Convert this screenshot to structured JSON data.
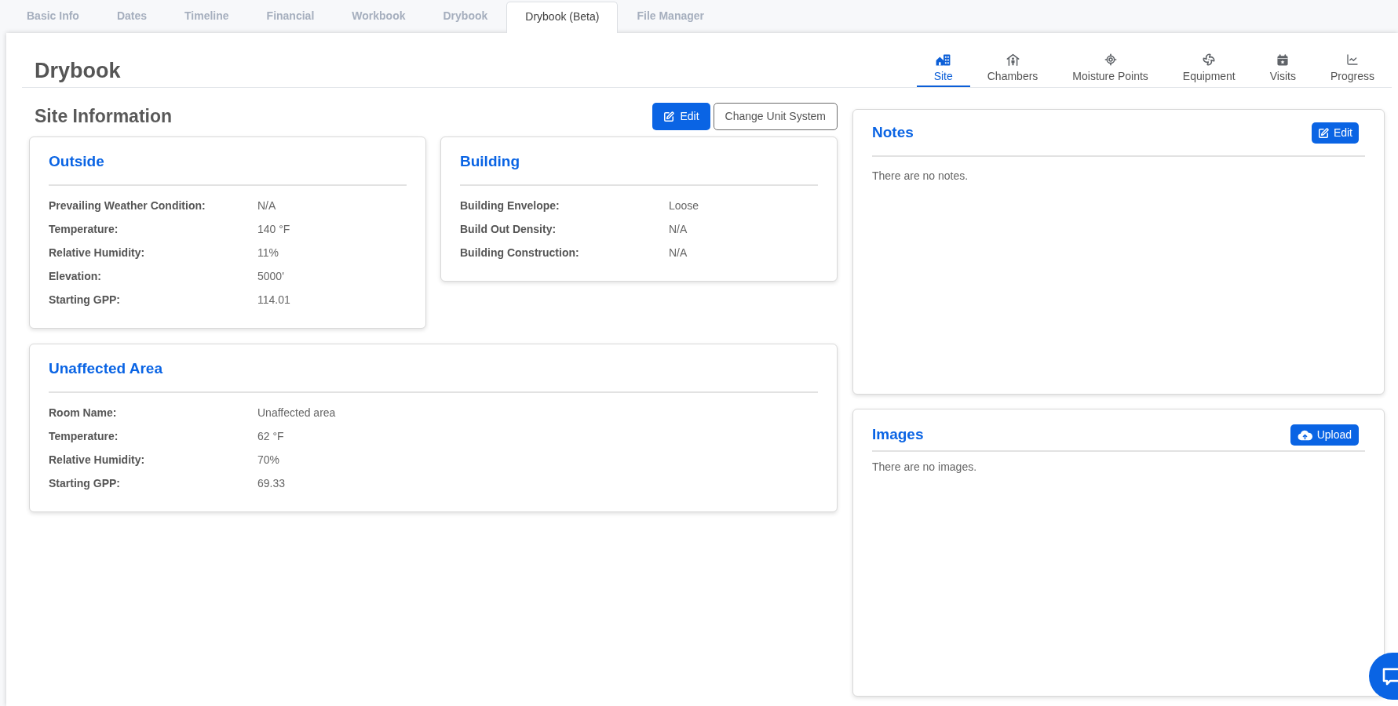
{
  "top_tabs": [
    {
      "label": "Basic Info",
      "selected": false
    },
    {
      "label": "Dates",
      "selected": false
    },
    {
      "label": "Timeline",
      "selected": false
    },
    {
      "label": "Financial",
      "selected": false
    },
    {
      "label": "Workbook",
      "selected": false
    },
    {
      "label": "Drybook",
      "selected": false
    },
    {
      "label": "Drybook (Beta)",
      "selected": true
    },
    {
      "label": "File Manager",
      "selected": false
    }
  ],
  "page_title": "Drybook",
  "section_tabs": [
    {
      "label": "Site",
      "selected": true
    },
    {
      "label": "Chambers",
      "selected": false
    },
    {
      "label": "Moisture Points",
      "selected": false
    },
    {
      "label": "Equipment",
      "selected": false
    },
    {
      "label": "Visits",
      "selected": false
    },
    {
      "label": "Progress",
      "selected": false
    }
  ],
  "site_information": {
    "title": "Site Information",
    "buttons": [
      {
        "label": "Edit",
        "kind": "primary"
      },
      {
        "label": "Change Unit System",
        "kind": "secondary"
      }
    ],
    "cards": [
      {
        "title": "Outside",
        "rows": [
          {
            "label": "Prevailing Weather Condition:",
            "value": "N/A"
          },
          {
            "label": "Temperature:",
            "value": "140 °F"
          },
          {
            "label": "Relative Humidity:",
            "value": "11%"
          },
          {
            "label": "Elevation:",
            "value": "5000'"
          },
          {
            "label": "Starting GPP:",
            "value": "114.01"
          }
        ]
      },
      {
        "title": "Building",
        "rows": [
          {
            "label": "Building Envelope:",
            "value": "Loose"
          },
          {
            "label": "Build Out Density:",
            "value": "N/A"
          },
          {
            "label": "Building Construction:",
            "value": "N/A"
          }
        ]
      },
      {
        "title": "Unaffected Area",
        "rows": [
          {
            "label": "Room Name:",
            "value": "Unaffected area"
          },
          {
            "label": "Temperature:",
            "value": "62 °F"
          },
          {
            "label": "Relative Humidity:",
            "value": "70%"
          },
          {
            "label": "Starting GPP:",
            "value": "69.33"
          }
        ]
      }
    ]
  },
  "notes": {
    "title": "Notes",
    "button": "Edit",
    "empty_text": "There are no notes."
  },
  "images": {
    "title": "Images",
    "button": "Upload",
    "empty_text": "There are no images."
  }
}
